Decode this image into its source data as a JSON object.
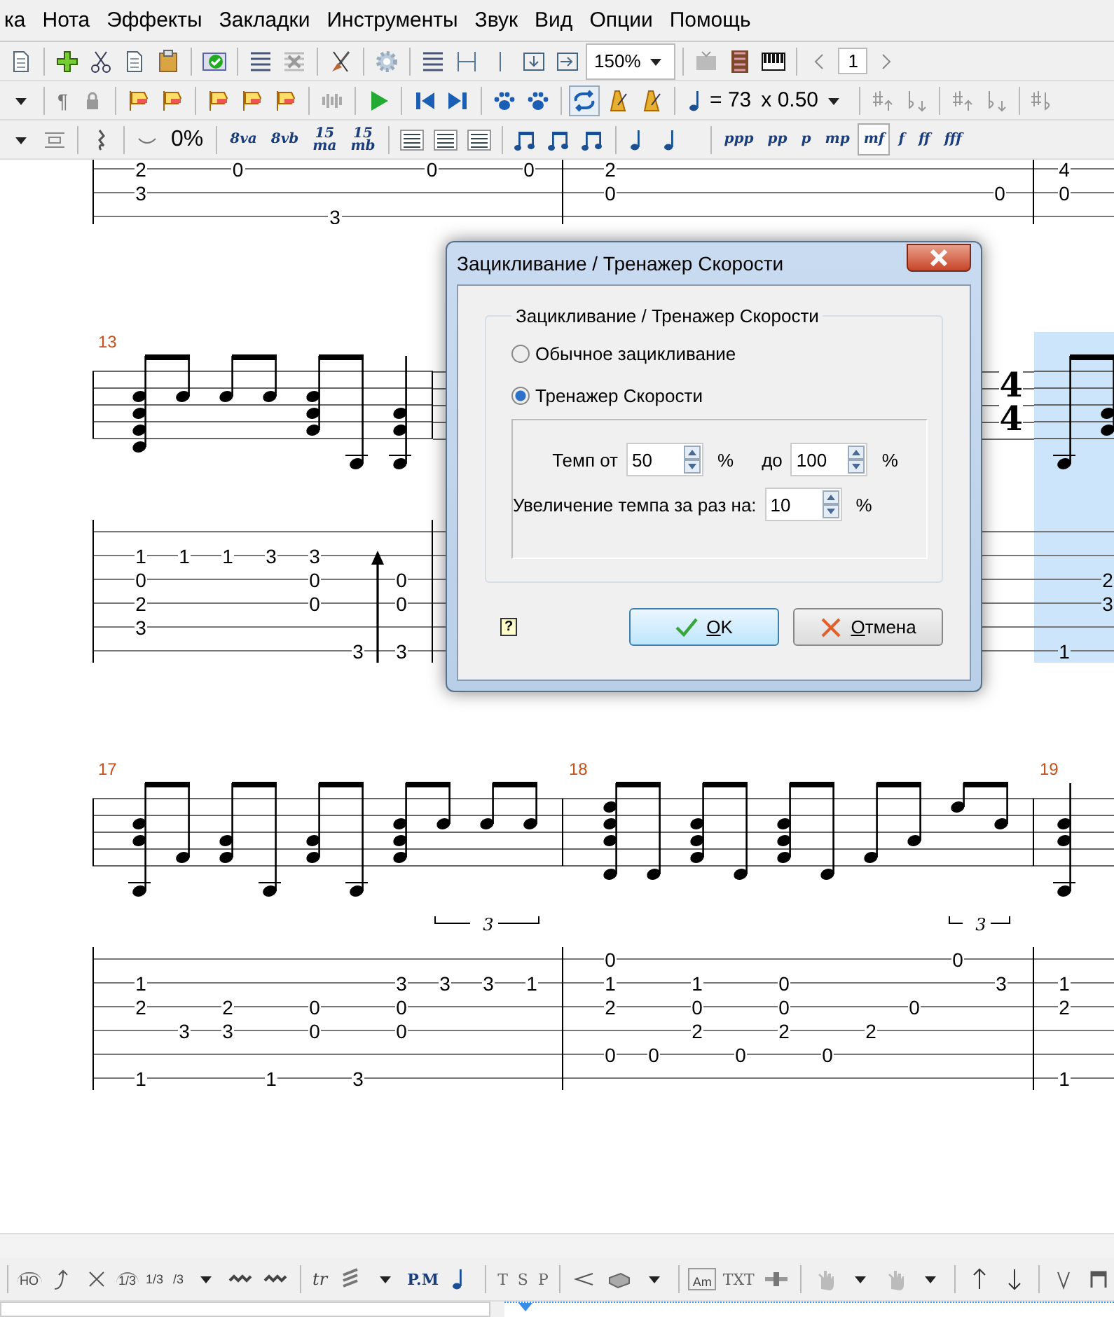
{
  "menu": [
    {
      "label": "ка"
    },
    {
      "label": "Нота"
    },
    {
      "label": "Эффекты"
    },
    {
      "label": "Закладки"
    },
    {
      "label": "Инструменты"
    },
    {
      "label": "Звук"
    },
    {
      "label": "Вид"
    },
    {
      "label": "Опции"
    },
    {
      "label": "Помощь"
    }
  ],
  "toolbar": {
    "zoom": "150%",
    "page": "1",
    "pilcrow": "¶",
    "tempo": "= 73",
    "speed": "x 0.50",
    "bend": "0%",
    "octaves": [
      "8va",
      "8vb",
      "15\nma",
      "15\nmb"
    ],
    "loop_selected": true,
    "dynamics": [
      {
        "label": "ppp",
        "selected": false
      },
      {
        "label": "pp",
        "selected": false
      },
      {
        "label": "p",
        "selected": false
      },
      {
        "label": "mp",
        "selected": false
      },
      {
        "label": "mf",
        "selected": true
      },
      {
        "label": "f",
        "selected": false
      },
      {
        "label": "ff",
        "selected": false
      },
      {
        "label": "fff",
        "selected": false
      }
    ]
  },
  "score": {
    "systems": [
      {
        "kind": "partial",
        "measures": [
          {
            "beats": [
              {
                "s4": "2",
                "s5": "3"
              },
              {
                "s4": "0"
              },
              {
                "s6": "3"
              },
              {
                "s4": "0"
              },
              {
                "s4": "0"
              }
            ]
          },
          {
            "beats": [
              {
                "s4": "2",
                "s5": "0"
              },
              {
                "s5": "0"
              }
            ]
          },
          {
            "beats": [
              {
                "s4": "4",
                "s5": "0"
              }
            ]
          }
        ]
      },
      {
        "kind": "full",
        "time_signature": [
          "4",
          "4"
        ],
        "measures": [
          {
            "number": "13",
            "beats": [
              {
                "s2": "1",
                "s3": "0",
                "s4": "2",
                "s5": "3"
              },
              {
                "s2": "1"
              },
              {
                "s2": "1"
              },
              {
                "s2": "3"
              },
              {
                "s2": "3",
                "s3": "0",
                "s4": "0"
              },
              {
                "s6": "3"
              },
              {
                "s3": "0",
                "s4": "0",
                "s6": "3",
                "strum_up": true
              }
            ]
          },
          {
            "selected": true,
            "beats": [
              {
                "s6": "1"
              },
              {
                "s3": "2",
                "s4": "3"
              }
            ]
          }
        ]
      },
      {
        "kind": "full",
        "measures": [
          {
            "number": "17",
            "tuplet_label": "3",
            "beats": [
              {
                "s2": "1",
                "s3": "2",
                "s6": "1"
              },
              {
                "s4": "3"
              },
              {
                "s3": "2",
                "s4": "3"
              },
              {
                "s6": "1"
              },
              {
                "s3": "0",
                "s4": "0"
              },
              {
                "s6": "3"
              },
              {
                "s2": "3",
                "s3": "0",
                "s4": "0"
              },
              {
                "s2": "3",
                "tuplet": true
              },
              {
                "s2": "3",
                "tuplet": true
              },
              {
                "s2": "1",
                "tuplet": true
              }
            ]
          },
          {
            "number": "18",
            "tuplet_label": "3",
            "beats": [
              {
                "s1": "0",
                "s2": "1",
                "s3": "2",
                "s5": "0"
              },
              {
                "s5": "0"
              },
              {
                "s2": "1",
                "s3": "0",
                "s4": "2"
              },
              {
                "s5": "0"
              },
              {
                "s2": "0",
                "s3": "0",
                "s4": "2"
              },
              {
                "s5": "0"
              },
              {
                "s4": "2"
              },
              {
                "s3": "0"
              },
              {
                "s1": "0",
                "tuplet": true
              },
              {
                "s2": "3",
                "tuplet": true
              }
            ]
          },
          {
            "number": "19",
            "beats": [
              {
                "s2": "1",
                "s3": "2",
                "s6": "1"
              }
            ]
          }
        ]
      }
    ]
  },
  "dialog": {
    "title": "Зацикливание / Тренажер Скорости",
    "group_title": "Зацикливание / Тренажер Скорости",
    "modes": [
      {
        "label": "Обычное зацикливание",
        "selected": false
      },
      {
        "label": "Тренажер Скорости",
        "selected": true
      }
    ],
    "tempo_from_label": "Темп от",
    "tempo_from": "50",
    "percent_1": "%",
    "tempo_to_label": "до",
    "tempo_to": "100",
    "percent_2": "%",
    "step_label": "Увеличение темпа за раз на:",
    "step": "10",
    "percent_3": "%",
    "help": "?",
    "buttons": [
      {
        "label": "OK",
        "kind": "ok"
      },
      {
        "label": "Отмена",
        "kind": "cancel"
      }
    ]
  },
  "bottom_toolbar": [
    "HO",
    "1/3",
    "1/3",
    "/3",
    "tr",
    "P.M",
    "T",
    "S",
    "P",
    "Am",
    "TXT"
  ]
}
